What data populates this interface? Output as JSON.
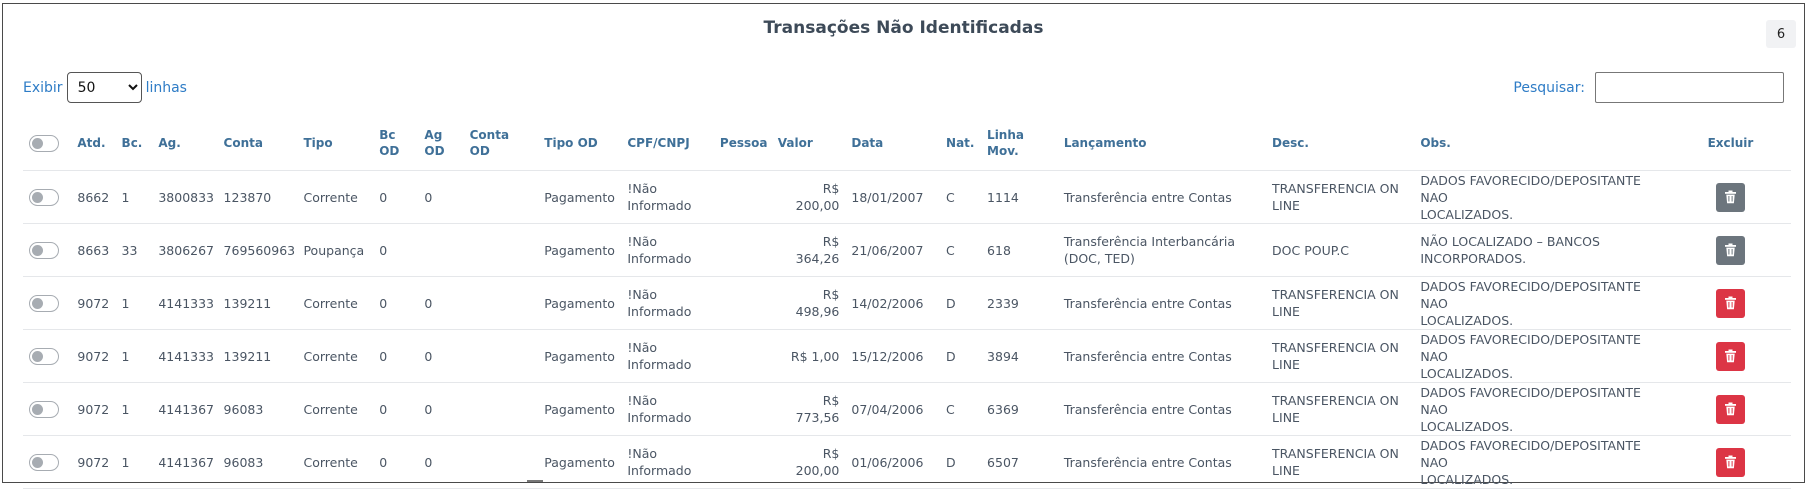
{
  "title": "Transações Não Identificadas",
  "badge_count": "6",
  "length_control": {
    "prefix": "Exibir",
    "value": "50",
    "suffix": "linhas"
  },
  "search": {
    "label": "Pesquisar:",
    "value": ""
  },
  "columns": {
    "atd": "Atd.",
    "bc": "Bc.",
    "ag": "Ag.",
    "conta": "Conta",
    "tipo": "Tipo",
    "bc_od_1": "Bc",
    "bc_od_2": "OD",
    "ag_od_1": "Ag",
    "ag_od_2": "OD",
    "conta_od_1": "Conta",
    "conta_od_2": "OD",
    "tipo_od": "Tipo OD",
    "cpf": "CPF/CNPJ",
    "pessoa": "Pessoa",
    "valor": "Valor",
    "data": "Data",
    "nat": "Nat.",
    "linha_mov_1": "Linha",
    "linha_mov_2": "Mov.",
    "lancamento": "Lançamento",
    "desc": "Desc.",
    "obs": "Obs.",
    "excluir": "Excluir"
  },
  "rows": [
    {
      "atd": "8662",
      "bc": "1",
      "ag": "3800833",
      "conta": "123870",
      "tipo": "Corrente",
      "bc_od": "0",
      "ag_od": "0",
      "conta_od": "",
      "tipo_od": "Pagamento",
      "cpf_1": "!Não",
      "cpf_2": "Informado",
      "pessoa": "",
      "valor_1": "R$",
      "valor_2": "200,00",
      "data": "18/01/2007",
      "nat": "C",
      "linha_mov": "1114",
      "lancamento_1": "Transferência entre Contas",
      "lancamento_2": "",
      "desc_1": "TRANSFERENCIA ON",
      "desc_2": "LINE",
      "obs_1": "DADOS FAVORECIDO/DEPOSITANTE NAO",
      "obs_2": "LOCALIZADOS.",
      "delete_style": "gray"
    },
    {
      "atd": "8663",
      "bc": "33",
      "ag": "3806267",
      "conta": "769560963",
      "tipo": "Poupança",
      "bc_od": "0",
      "ag_od": "",
      "conta_od": "",
      "tipo_od": "Pagamento",
      "cpf_1": "!Não",
      "cpf_2": "Informado",
      "pessoa": "",
      "valor_1": "R$",
      "valor_2": "364,26",
      "data": "21/06/2007",
      "nat": "C",
      "linha_mov": "618",
      "lancamento_1": "Transferência Interbancária",
      "lancamento_2": "(DOC, TED)",
      "desc_1": "DOC POUP.C",
      "desc_2": "",
      "obs_1": "NÃO LOCALIZADO – BANCOS",
      "obs_2": "INCORPORADOS.",
      "delete_style": "gray"
    },
    {
      "atd": "9072",
      "bc": "1",
      "ag": "4141333",
      "conta": "139211",
      "tipo": "Corrente",
      "bc_od": "0",
      "ag_od": "0",
      "conta_od": "",
      "tipo_od": "Pagamento",
      "cpf_1": "!Não",
      "cpf_2": "Informado",
      "pessoa": "",
      "valor_1": "R$",
      "valor_2": "498,96",
      "data": "14/02/2006",
      "nat": "D",
      "linha_mov": "2339",
      "lancamento_1": "Transferência entre Contas",
      "lancamento_2": "",
      "desc_1": "TRANSFERENCIA ON",
      "desc_2": "LINE",
      "obs_1": "DADOS FAVORECIDO/DEPOSITANTE NAO",
      "obs_2": "LOCALIZADOS.",
      "delete_style": "red"
    },
    {
      "atd": "9072",
      "bc": "1",
      "ag": "4141333",
      "conta": "139211",
      "tipo": "Corrente",
      "bc_od": "0",
      "ag_od": "0",
      "conta_od": "",
      "tipo_od": "Pagamento",
      "cpf_1": "!Não",
      "cpf_2": "Informado",
      "pessoa": "",
      "valor_1": "R$ 1,00",
      "valor_2": "",
      "data": "15/12/2006",
      "nat": "D",
      "linha_mov": "3894",
      "lancamento_1": "Transferência entre Contas",
      "lancamento_2": "",
      "desc_1": "TRANSFERENCIA ON",
      "desc_2": "LINE",
      "obs_1": "DADOS FAVORECIDO/DEPOSITANTE NAO",
      "obs_2": "LOCALIZADOS.",
      "delete_style": "red"
    },
    {
      "atd": "9072",
      "bc": "1",
      "ag": "4141367",
      "conta": "96083",
      "tipo": "Corrente",
      "bc_od": "0",
      "ag_od": "0",
      "conta_od": "",
      "tipo_od": "Pagamento",
      "cpf_1": "!Não",
      "cpf_2": "Informado",
      "pessoa": "",
      "valor_1": "R$",
      "valor_2": "773,56",
      "data": "07/04/2006",
      "nat": "C",
      "linha_mov": "6369",
      "lancamento_1": "Transferência entre Contas",
      "lancamento_2": "",
      "desc_1": "TRANSFERENCIA ON",
      "desc_2": "LINE",
      "obs_1": "DADOS FAVORECIDO/DEPOSITANTE NAO",
      "obs_2": "LOCALIZADOS.",
      "delete_style": "red"
    },
    {
      "atd": "9072",
      "bc": "1",
      "ag": "4141367",
      "conta": "96083",
      "tipo": "Corrente",
      "bc_od": "0",
      "ag_od": "0",
      "conta_od": "",
      "tipo_od": "Pagamento",
      "cpf_1": "!Não",
      "cpf_2": "Informado",
      "pessoa": "",
      "valor_1": "R$",
      "valor_2": "200,00",
      "data": "01/06/2006",
      "nat": "D",
      "linha_mov": "6507",
      "lancamento_1": "Transferência entre Contas",
      "lancamento_2": "",
      "desc_1": "TRANSFERENCIA ON",
      "desc_2": "LINE",
      "obs_1": "DADOS FAVORECIDO/DEPOSITANTE NAO",
      "obs_2": "LOCALIZADOS.",
      "delete_style": "red"
    }
  ],
  "colors": {
    "link_blue": "#2e7cc6",
    "header_blue": "#3f7098",
    "delete_gray": "#6c757d",
    "delete_red": "#dc3545"
  },
  "icons": {
    "row_select": "toggle-switch-icon",
    "delete": "trash-icon"
  }
}
